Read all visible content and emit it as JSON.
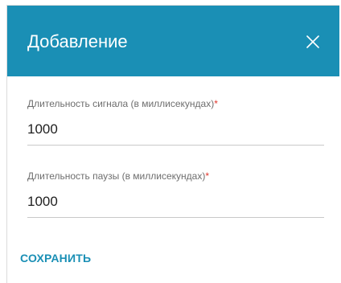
{
  "dialog": {
    "title": "Добавление",
    "close_icon": "close-icon"
  },
  "fields": {
    "signal_duration": {
      "label": "Длительность сигнала (в миллисекундах)",
      "required_mark": "*",
      "value": "1000"
    },
    "pause_duration": {
      "label": "Длительность паузы (в миллисекундах)",
      "required_mark": "*",
      "value": "1000"
    }
  },
  "actions": {
    "save_label": "СОХРАНИТЬ"
  },
  "colors": {
    "header_bg": "#1a8fb5",
    "accent": "#1a8fb5",
    "required": "#e0352b"
  }
}
